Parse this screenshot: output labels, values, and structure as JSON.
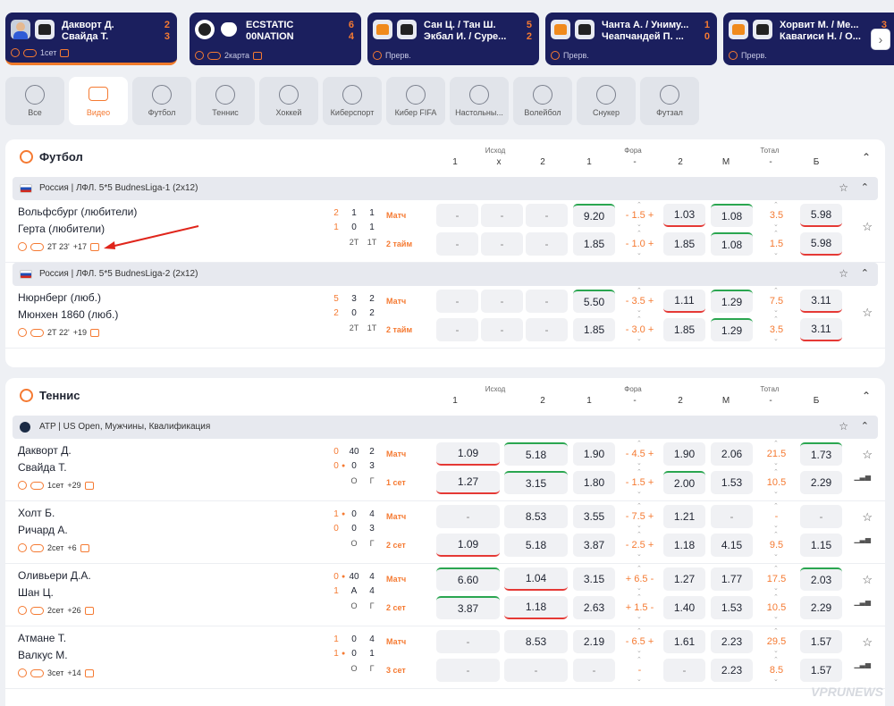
{
  "top_matches": [
    {
      "team1": "Дакворт Д.",
      "team2": "Свайда Т.",
      "score1": "2",
      "score2": "3",
      "meta": "1сет"
    },
    {
      "team1": "ECSTATIC",
      "team2": "00NATION",
      "score1": "6",
      "score2": "4",
      "meta": "2карта"
    },
    {
      "team1": "Сан Ц. / Тан Ш.",
      "team2": "Экбал И. / Суре...",
      "score1": "5",
      "score2": "2",
      "meta": "Прерв."
    },
    {
      "team1": "Чанта А. / Униму...",
      "team2": "Чеапчандей П. ...",
      "score1": "1",
      "score2": "0",
      "meta": "Прерв."
    },
    {
      "team1": "Хорвит М. / Ме...",
      "team2": "Кавагиси Н. / О...",
      "score1": "3",
      "score2": "",
      "meta": "Прерв."
    }
  ],
  "sports": [
    {
      "label": "Все",
      "icon": "check-circle-icon"
    },
    {
      "label": "Видео",
      "icon": "video-icon"
    },
    {
      "label": "Футбол",
      "icon": "football-icon"
    },
    {
      "label": "Теннис",
      "icon": "tennis-icon"
    },
    {
      "label": "Хоккей",
      "icon": "hockey-icon"
    },
    {
      "label": "Киберспорт",
      "icon": "gamepad-icon"
    },
    {
      "label": "Кибер FIFA",
      "icon": "cyber-fifa-icon"
    },
    {
      "label": "Настольны...",
      "icon": "table-tennis-icon"
    },
    {
      "label": "Волейбол",
      "icon": "volleyball-icon"
    },
    {
      "label": "Снукер",
      "icon": "snooker-icon"
    },
    {
      "label": "Футзал",
      "icon": "futsal-icon"
    }
  ],
  "columns": {
    "ishod": "Исход",
    "fora": "Фора",
    "total": "Тотал",
    "c1": "1",
    "cx": "x",
    "c2": "2",
    "f1": "1",
    "fdash": "-",
    "f2": "2",
    "m": "М",
    "tdash": "-",
    "b": "Б"
  },
  "football": {
    "title": "Футбол",
    "leagues": [
      {
        "name": "Россия | ЛФЛ. 5*5 BudnesLiga-1 (2x12)",
        "event": {
          "team1": "Вольфсбург (любители)",
          "team2": "Герта (любители)",
          "s1": [
            "2",
            "1",
            "1"
          ],
          "s2": [
            "1",
            "0",
            "1"
          ],
          "sl": [
            "",
            "2Т",
            "1Т"
          ],
          "meta": "2Т 23'",
          "more": "+17",
          "rows": [
            {
              "label": "Матч",
              "o1": "-",
              "ox": "-",
              "o2": "-",
              "f1": "9.20",
              "fh": "- 1.5 +",
              "f2": "1.03",
              "m": "1.08",
              "th": "3.5",
              "b": "5.98"
            },
            {
              "label": "2 тайм",
              "o1": "-",
              "ox": "-",
              "o2": "-",
              "f1": "1.85",
              "fh": "- 1.0 +",
              "f2": "1.85",
              "m": "1.08",
              "th": "1.5",
              "b": "5.98"
            }
          ]
        }
      },
      {
        "name": "Россия | ЛФЛ. 5*5 BudnesLiga-2 (2x12)",
        "event": {
          "team1": "Нюрнберг (люб.)",
          "team2": "Мюнхен 1860 (люб.)",
          "s1": [
            "5",
            "3",
            "2"
          ],
          "s2": [
            "2",
            "0",
            "2"
          ],
          "sl": [
            "",
            "2Т",
            "1Т"
          ],
          "meta": "2Т 22'",
          "more": "+19",
          "rows": [
            {
              "label": "Матч",
              "o1": "-",
              "ox": "-",
              "o2": "-",
              "f1": "5.50",
              "fh": "- 3.5 +",
              "f2": "1.11",
              "m": "1.29",
              "th": "7.5",
              "b": "3.11"
            },
            {
              "label": "2 тайм",
              "o1": "-",
              "ox": "-",
              "o2": "-",
              "f1": "1.85",
              "fh": "- 3.0 +",
              "f2": "1.85",
              "m": "1.29",
              "th": "3.5",
              "b": "3.11"
            }
          ]
        }
      }
    ]
  },
  "tennis": {
    "title": "Теннис",
    "league": "ATP | US Open, Мужчины, Квалификация",
    "events": [
      {
        "team1": "Дакворт Д.",
        "team2": "Свайда Т.",
        "s1": [
          "0",
          "40",
          "2"
        ],
        "s2": [
          "0",
          "0",
          "3"
        ],
        "sl": [
          "",
          "О",
          "Г"
        ],
        "dot": 2,
        "meta": "1сет",
        "more": "+29",
        "rows": [
          {
            "label": "Матч",
            "o1": "1.09",
            "o2": "5.18",
            "f1": "1.90",
            "fh": "- 4.5 +",
            "f2": "1.90",
            "m": "2.06",
            "th": "21.5",
            "b": "1.73"
          },
          {
            "label": "1 сет",
            "o1": "1.27",
            "o2": "3.15",
            "f1": "1.80",
            "fh": "- 1.5 +",
            "f2": "2.00",
            "m": "1.53",
            "th": "10.5",
            "b": "2.29"
          }
        ]
      },
      {
        "team1": "Холт Б.",
        "team2": "Ричард А.",
        "s1": [
          "1",
          "0",
          "4"
        ],
        "s2": [
          "0",
          "0",
          "3"
        ],
        "sl": [
          "",
          "О",
          "Г"
        ],
        "dot": 1,
        "meta": "2сет",
        "more": "+6",
        "rows": [
          {
            "label": "Матч",
            "o1": "-",
            "o2": "8.53",
            "f1": "3.55",
            "fh": "- 7.5 +",
            "f2": "1.21",
            "m": "-",
            "th": "-",
            "b": "-"
          },
          {
            "label": "2 сет",
            "o1": "1.09",
            "o2": "5.18",
            "f1": "3.87",
            "fh": "- 2.5 +",
            "f2": "1.18",
            "m": "4.15",
            "th": "9.5",
            "b": "1.15"
          }
        ]
      },
      {
        "team1": "Оливьери Д.А.",
        "team2": "Шан Ц.",
        "s1": [
          "0",
          "40",
          "4"
        ],
        "s2": [
          "1",
          "А",
          "4"
        ],
        "sl": [
          "",
          "О",
          "Г"
        ],
        "dot": 1,
        "meta": "2сет",
        "more": "+26",
        "rows": [
          {
            "label": "Матч",
            "o1": "6.60",
            "o2": "1.04",
            "f1": "3.15",
            "fh": "+ 6.5 -",
            "f2": "1.27",
            "m": "1.77",
            "th": "17.5",
            "b": "2.03"
          },
          {
            "label": "2 сет",
            "o1": "3.87",
            "o2": "1.18",
            "f1": "2.63",
            "fh": "+ 1.5 -",
            "f2": "1.40",
            "m": "1.53",
            "th": "10.5",
            "b": "2.29"
          }
        ]
      },
      {
        "team1": "Атмане Т.",
        "team2": "Валкус М.",
        "s1": [
          "1",
          "0",
          "4"
        ],
        "s2": [
          "1",
          "0",
          "1"
        ],
        "sl": [
          "",
          "О",
          "Г"
        ],
        "dot": 2,
        "meta": "3сет",
        "more": "+14",
        "rows": [
          {
            "label": "Матч",
            "o1": "-",
            "o2": "8.53",
            "f1": "2.19",
            "fh": "- 6.5 +",
            "f2": "1.61",
            "m": "2.23",
            "th": "29.5",
            "b": "1.57"
          },
          {
            "label": "3 сет",
            "o1": "-",
            "o2": "-",
            "f1": "-",
            "fh": "-",
            "f2": "-",
            "m": "2.23",
            "th": "8.5",
            "b": "1.57"
          }
        ]
      }
    ]
  },
  "watermark": "VPRUNEWS"
}
